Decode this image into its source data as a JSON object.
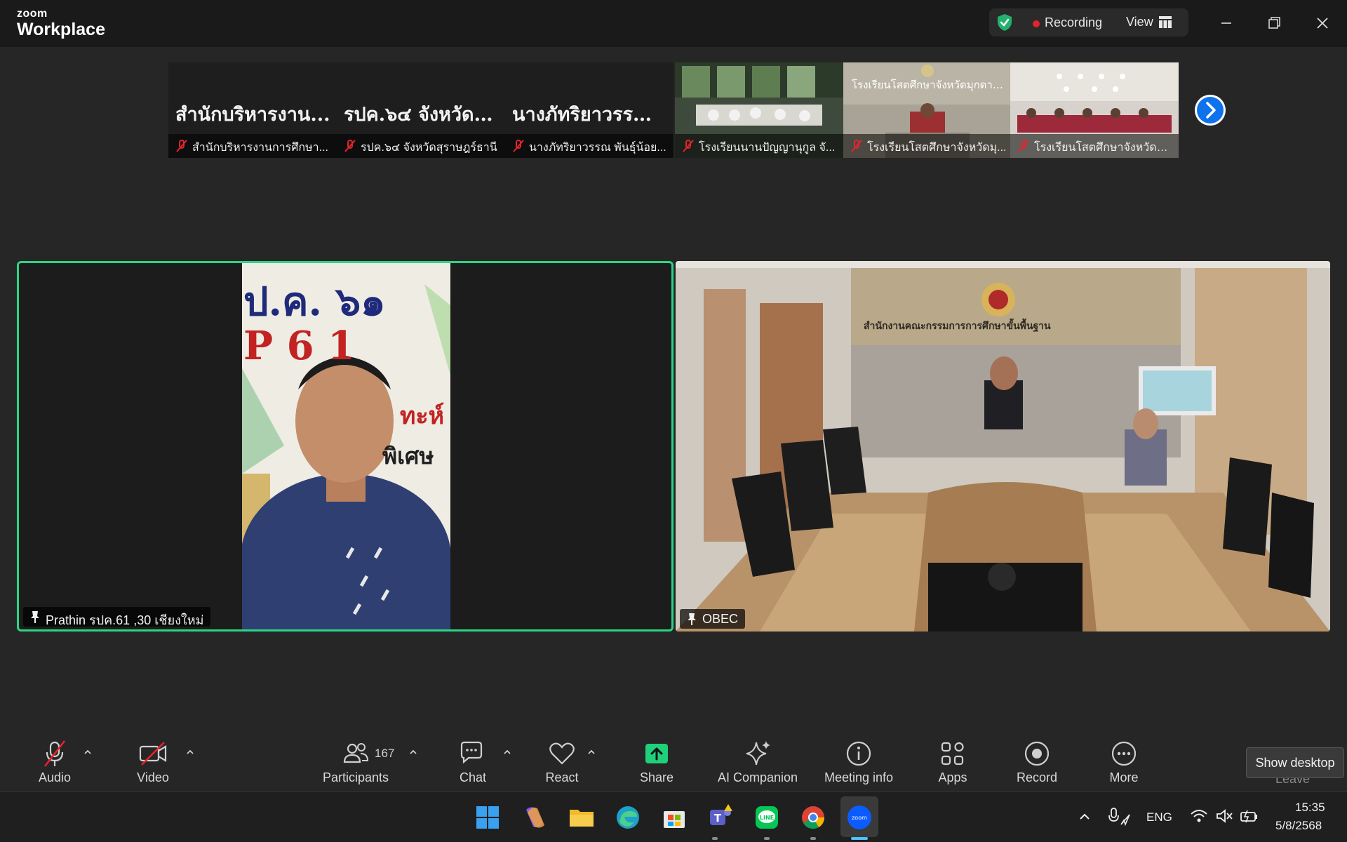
{
  "window": {
    "brand_small": "zoom",
    "brand_large": "Workplace",
    "recording_label": "Recording",
    "view_label": "View"
  },
  "filmstrip": [
    {
      "title": "สำนักบริหารงาน...",
      "caption": "สำนักบริหารงานการศึกษา...",
      "type": "text"
    },
    {
      "title": "รปค.๖๔ จังหวัดสุ...",
      "caption": "รปค.๖๔ จังหวัดสุราษฎร์ธานี",
      "type": "text"
    },
    {
      "title": "นางภัทริยาวรรณ...",
      "caption": "นางภัทริยาวรรณ พันธุ์น้อย...",
      "type": "text"
    },
    {
      "title": "",
      "caption": "โรงเรียนนานปัญญานุกูล จั...",
      "type": "video"
    },
    {
      "title": "",
      "caption": "โรงเรียนโสตศึกษาจังหวัดมุ...",
      "type": "video",
      "overlay": "โรงเรียนโสตศึกษาจังหวัดมุกดาหาร"
    },
    {
      "title": "",
      "caption": "โรงเรียนโสตศึกษาจังหวัดสง...",
      "type": "video"
    }
  ],
  "main_videos": {
    "left_name": "Prathin รปค.61 ,30 เชียงใหม่",
    "left_backdrop_line1": "ป.ค. ๖๑",
    "left_backdrop_line2": "P 6 1",
    "left_backdrop_line3": "ทะห์ 61",
    "left_backdrop_line4": "พิเศษ",
    "right_name": "OBEC",
    "right_wall_sign": "สำนักงานคณะกรรมการการศึกษาขั้นพื้นฐาน"
  },
  "toolbar": {
    "audio": "Audio",
    "video": "Video",
    "participants": "Participants",
    "participants_count": "167",
    "chat": "Chat",
    "react": "React",
    "share": "Share",
    "ai_companion": "AI Companion",
    "meeting_info": "Meeting info",
    "apps": "Apps",
    "record": "Record",
    "more": "More",
    "leave": "Leave",
    "tooltip": "Show desktop"
  },
  "taskbar": {
    "language": "ENG",
    "time": "15:35",
    "date": "5/8/2568"
  },
  "colors": {
    "active_speaker": "#2ad585",
    "share_green": "#1fcf7a",
    "recording_red": "#e5232f",
    "link_blue": "#0e72ed"
  }
}
